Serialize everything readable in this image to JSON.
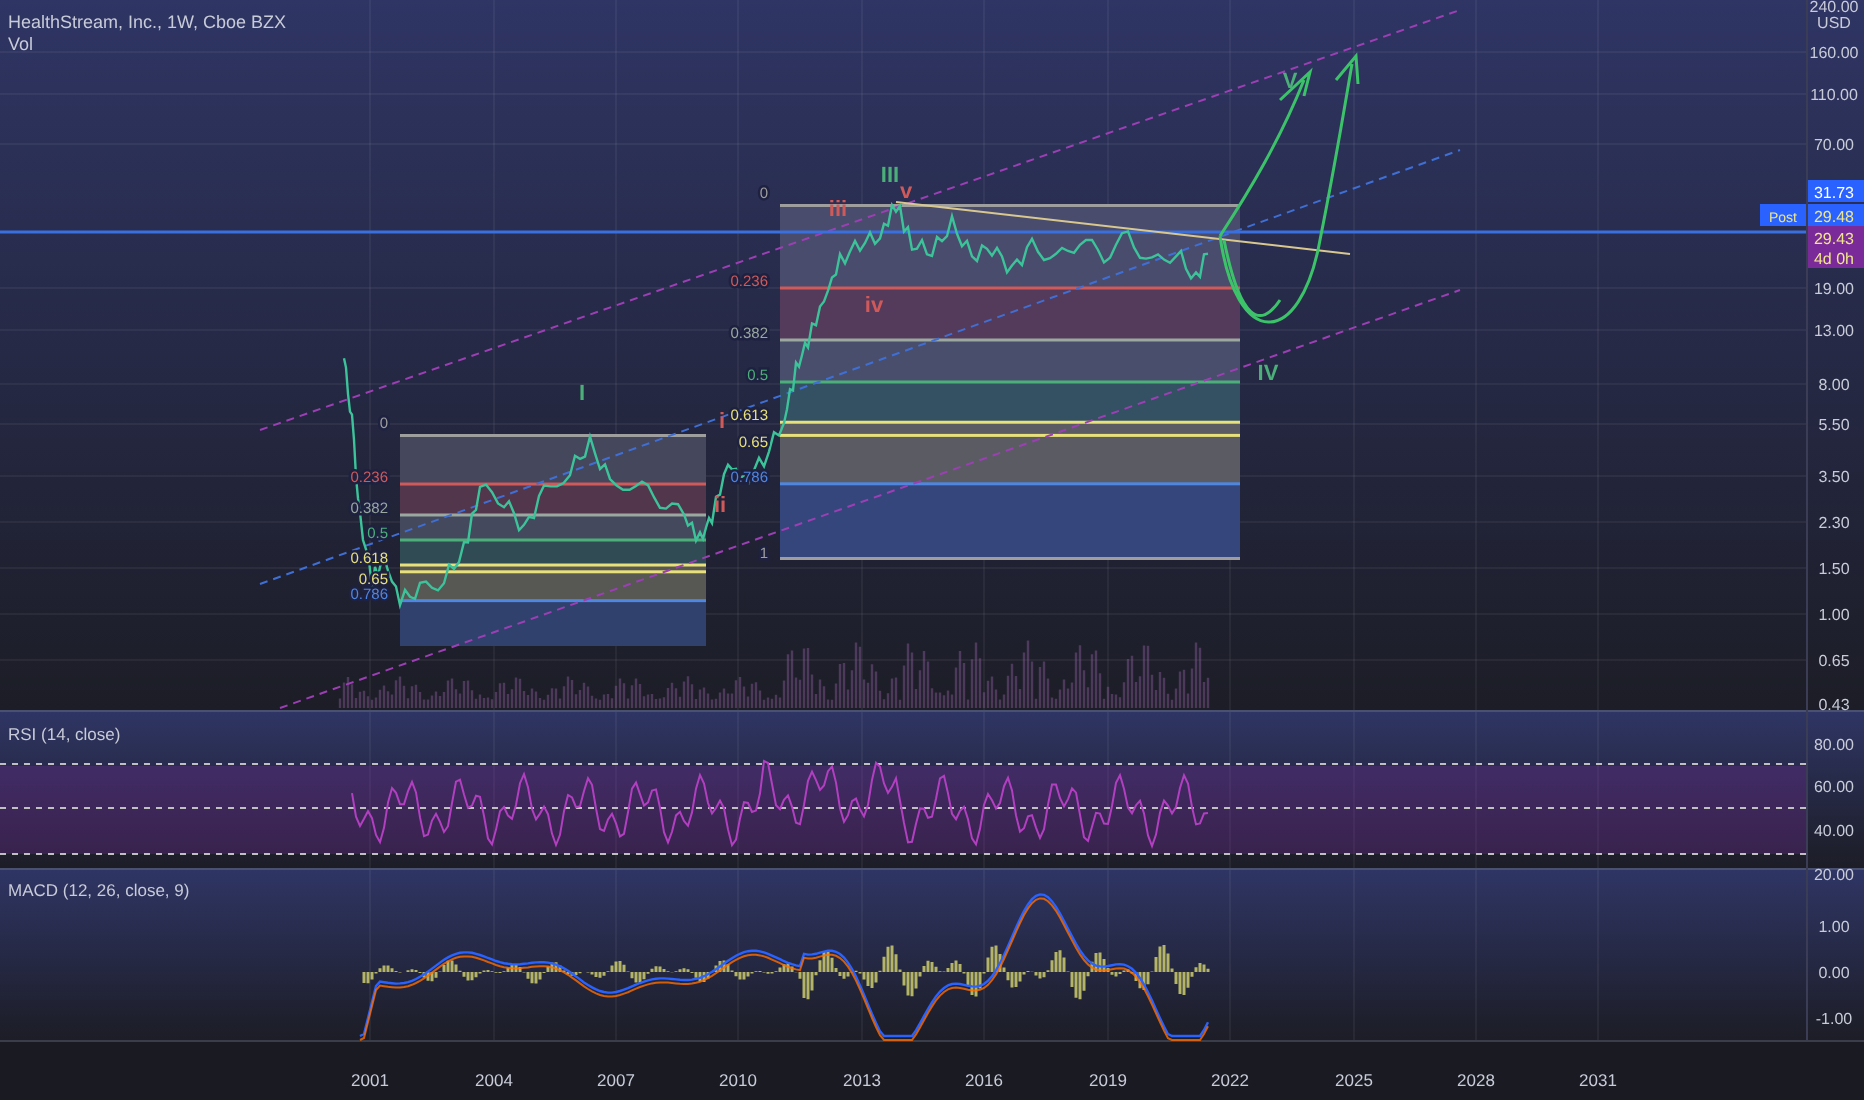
{
  "legend": {
    "title": "HealthStream, Inc., 1W, Cboe BZX",
    "volume": "Vol"
  },
  "price_axis": {
    "top_tick": "240.00",
    "currency": "USD",
    "ticks": [
      "160.00",
      "110.00",
      "70.00",
      "19.00",
      "13.00",
      "8.00",
      "5.50",
      "3.50",
      "2.30",
      "1.50",
      "1.00",
      "0.65",
      "0.43"
    ]
  },
  "price_tags": [
    {
      "kind": "level",
      "text": "31.73"
    },
    {
      "kind": "last",
      "text": "29.48",
      "tag": "Post"
    },
    {
      "kind": "close",
      "text": "29.43"
    },
    {
      "kind": "countdown",
      "text": "4d 0h"
    }
  ],
  "fib_retracements": [
    {
      "levels": [
        {
          "label": "0",
          "color": "#9e9e9e"
        },
        {
          "label": "0.236",
          "color": "#d05a5a"
        },
        {
          "label": "0.382",
          "color": "#9aa8a0"
        },
        {
          "label": "0.5",
          "color": "#4caf7a"
        },
        {
          "label": "0.618",
          "color": "#e8e07a"
        },
        {
          "label": "0.65",
          "color": "#e8e07a"
        },
        {
          "label": "0.786",
          "color": "#4f86e0"
        }
      ]
    },
    {
      "levels": [
        {
          "label": "0",
          "color": "#9e9e9e"
        },
        {
          "label": "0.236",
          "color": "#d05a5a"
        },
        {
          "label": "0.382",
          "color": "#9aa8a0"
        },
        {
          "label": "0.5",
          "color": "#4caf7a"
        },
        {
          "label": "0.613",
          "color": "#e8e07a"
        },
        {
          "label": "0.65",
          "color": "#e8e07a"
        },
        {
          "label": "0.786",
          "color": "#4f86e0"
        },
        {
          "label": "1",
          "color": "#9e9e9e"
        }
      ]
    }
  ],
  "wave_labels": [
    {
      "text": "III",
      "color": "#4caf7a"
    },
    {
      "text": "v",
      "color": "#d05a5a"
    },
    {
      "text": "iii",
      "color": "#d05a5a"
    },
    {
      "text": "iv",
      "color": "#d05a5a"
    },
    {
      "text": "I",
      "color": "#4caf7a"
    },
    {
      "text": "i",
      "color": "#d05a5a"
    },
    {
      "text": "ii",
      "color": "#d05a5a"
    },
    {
      "text": "IV",
      "color": "#4caf7a"
    },
    {
      "text": "V",
      "color": "#4caf7a"
    }
  ],
  "rsi": {
    "title": "RSI (14, close)",
    "ticks": [
      "80.00",
      "60.00",
      "40.00",
      "20.00"
    ]
  },
  "macd": {
    "title": "MACD (12, 26, close, 9)",
    "ticks": [
      "1.00",
      "0.00",
      "-1.00"
    ]
  },
  "time_axis": [
    "2001",
    "2004",
    "2007",
    "2010",
    "2013",
    "2016",
    "2019",
    "2022",
    "2025",
    "2028",
    "2031"
  ]
}
